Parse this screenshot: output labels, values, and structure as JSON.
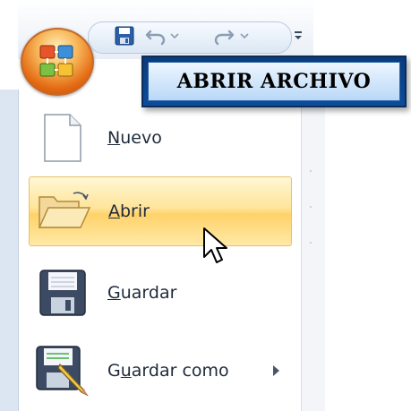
{
  "banner": {
    "title": "ABRIR ARCHIVO"
  },
  "quick_access_toolbar": {
    "buttons": [
      {
        "name": "save",
        "icon": "floppy-disk-icon"
      },
      {
        "name": "undo",
        "icon": "undo-icon"
      },
      {
        "name": "undo-dropdown",
        "icon": "chevron-down-icon"
      },
      {
        "name": "redo",
        "icon": "redo-icon"
      },
      {
        "name": "redo-dropdown",
        "icon": "chevron-down-icon"
      },
      {
        "name": "customize",
        "icon": "customize-qat-icon"
      }
    ]
  },
  "office_button": {
    "icon": "office-logo-icon"
  },
  "menu": {
    "items": [
      {
        "label": "Nuevo",
        "mnemonic": "N",
        "rest": "uevo",
        "icon": "new-document-icon",
        "highlighted": false,
        "has_submenu": false
      },
      {
        "label": "Abrir",
        "mnemonic": "A",
        "rest": "brir",
        "icon": "open-folder-icon",
        "highlighted": true,
        "has_submenu": false
      },
      {
        "label": "Guardar",
        "mnemonic": "G",
        "rest": "uardar",
        "icon": "save-floppy-icon",
        "highlighted": false,
        "has_submenu": false
      },
      {
        "label": "Guardar como",
        "prefix": "G",
        "mnemonic": "u",
        "rest": "ardar como",
        "icon": "save-as-icon",
        "highlighted": false,
        "has_submenu": true
      }
    ]
  },
  "colors": {
    "highlight": "#ffd26a",
    "banner_border": "#0b3b7a",
    "banner_fill": "#b9d8f7",
    "menu_background": "#dce6f3"
  },
  "cursor": {
    "icon": "mouse-pointer-icon"
  }
}
